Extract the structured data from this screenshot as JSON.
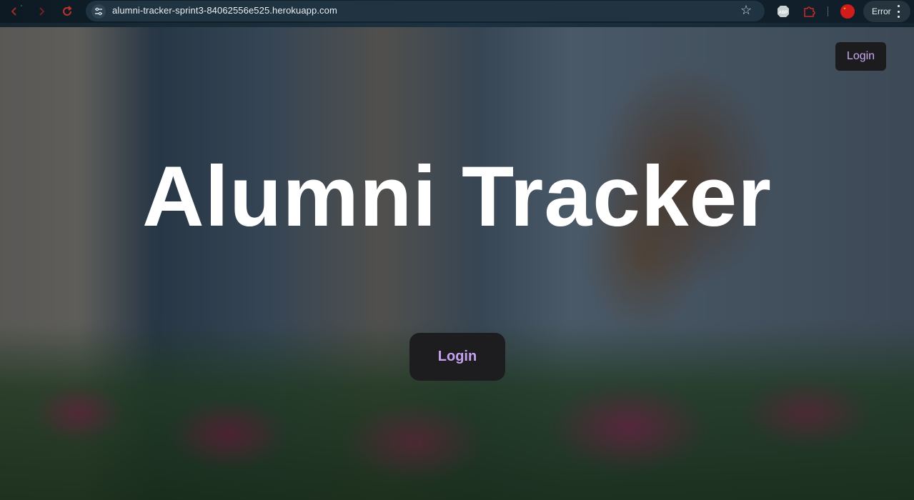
{
  "browser": {
    "url": "alumni-tracker-sprint3-84062556e525.herokuapp.com",
    "profile_status": "Error",
    "icons": {
      "back": "back-arrow-icon",
      "forward": "forward-arrow-icon",
      "reload": "reload-icon",
      "site_settings": "tune-icon",
      "bookmark": "star-icon",
      "extension_1": "adblock-icon",
      "extension_2": "puzzle-icon",
      "profile": "avatar-icon",
      "menu": "three-dot-menu-icon"
    }
  },
  "page": {
    "header_login": "Login",
    "title": "Alumni Tracker",
    "hero_login": "Login"
  },
  "colors": {
    "button_bg": "#1c1c1e",
    "button_text": "#c7a2f3",
    "title_text": "#ffffff"
  }
}
